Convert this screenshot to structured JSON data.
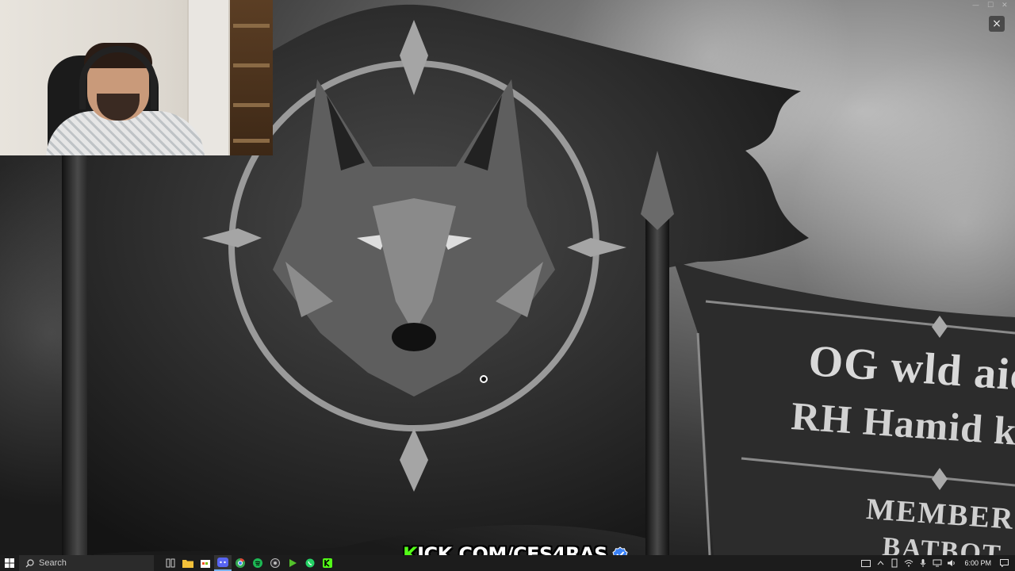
{
  "banner": {
    "line1": "OG wld aic",
    "line2": "RH Hamid kl",
    "members_label": "MEMBERS:",
    "member_partial": "BATBOT"
  },
  "watermark": {
    "kick_k": "K",
    "kick_rest": "ICK.COM/CES4RAS"
  },
  "overlay": {
    "close_glyph": "×"
  },
  "taskbar": {
    "search_placeholder": "Search",
    "clock": "6:00 PM",
    "pinned_apps": [
      "task-view",
      "file-explorer",
      "microsoft-store",
      "discord",
      "chrome",
      "spotify",
      "obs",
      "media-player",
      "whatsapp",
      "kick"
    ]
  },
  "colors": {
    "kick_green": "#53fc18",
    "taskbar_bg": "#1c1c1c",
    "verified_blue": "#3b82f6"
  }
}
